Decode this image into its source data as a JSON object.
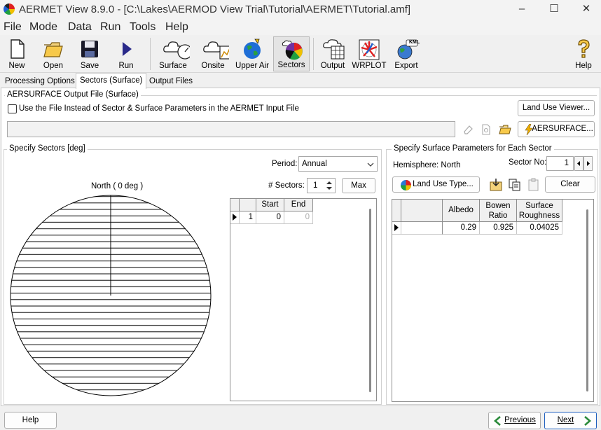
{
  "window": {
    "title": "AERMET View 8.9.0 - [C:\\Lakes\\AERMOD View Trial\\Tutorial\\AERMET\\Tutorial.amf]",
    "minimize": "–",
    "maximize": "☐",
    "close": "✕"
  },
  "menu": [
    "File",
    "Mode",
    "Data",
    "Run",
    "Tools",
    "Help"
  ],
  "toolbar": {
    "new": "New",
    "open": "Open",
    "save": "Save",
    "run": "Run",
    "surface": "Surface",
    "onsite": "Onsite",
    "upper_air": "Upper Air",
    "sectors": "Sectors",
    "output": "Output",
    "wrplot": "WRPLOT",
    "export": "Export",
    "help": "Help",
    "kml_badge": "KML"
  },
  "tabs": [
    "Processing Options",
    "Sectors (Surface)",
    "Output Files"
  ],
  "aersurface": {
    "group_title": "AERSURFACE Output File (Surface)",
    "checkbox_label": "Use the File Instead of Sector & Surface Parameters in the AERMET Input File",
    "checked": false,
    "land_use_viewer": "Land Use Viewer...",
    "file_path": "",
    "aersurface_button": "AERSURFACE..."
  },
  "sectors": {
    "group_title": "Specify Sectors [deg]",
    "north_label": "North ( 0 deg )",
    "period_label": "Period:",
    "period_value": "Annual",
    "num_sectors_label": "# Sectors:",
    "num_sectors_value": "1",
    "max_button": "Max",
    "columns": [
      "Start",
      "End"
    ],
    "rows": [
      {
        "index": "1",
        "start": "0",
        "end": "0"
      }
    ]
  },
  "surface": {
    "group_title": "Specify Surface Parameters for Each Sector",
    "hemisphere": "Hemisphere: North",
    "sector_no_label": "Sector No:",
    "sector_no_value": "1",
    "land_use_type": "Land Use Type...",
    "clear_button": "Clear",
    "columns": [
      "Albedo",
      "Bowen Ratio",
      "Surface Roughness"
    ],
    "rows": [
      {
        "albedo": "0.29",
        "bowen": "0.925",
        "roughness": "0.04025"
      }
    ]
  },
  "bottom": {
    "help": "Help",
    "previous": "Previous",
    "next": "Next"
  },
  "colors": {
    "accent_blue": "#1f5fbf",
    "globe_blue": "#1e6ed6",
    "next_green": "#2a8a3a"
  }
}
